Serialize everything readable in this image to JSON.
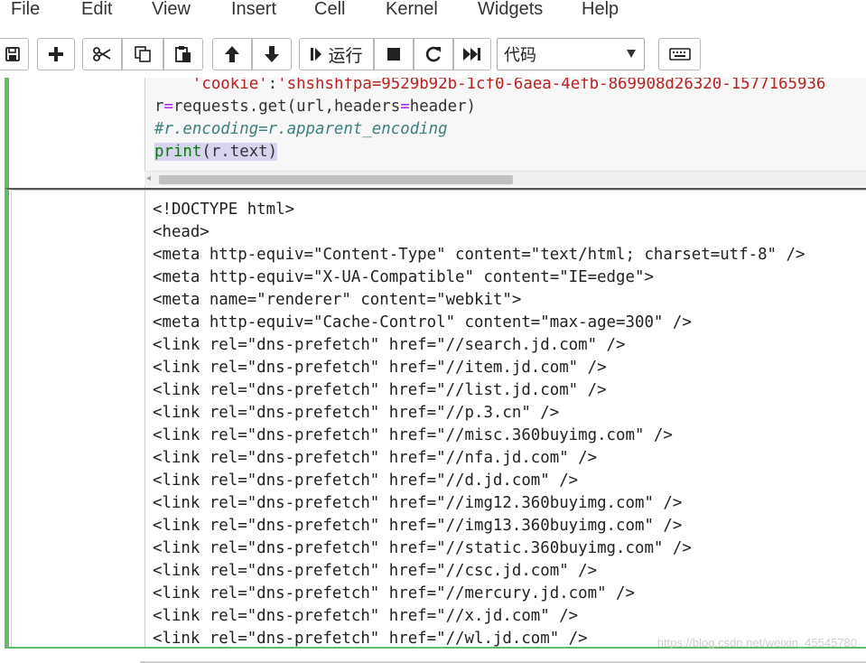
{
  "menu": [
    "File",
    "Edit",
    "View",
    "Insert",
    "Cell",
    "Kernel",
    "Widgets",
    "Help"
  ],
  "toolbar": {
    "run_label": "运行",
    "cell_type": "代码"
  },
  "cell1": {
    "lines": [
      {
        "parts": [
          [
            "",
            "    "
          ],
          [
            "str",
            "'cookie'"
          ],
          [
            "",
            ":"
          ],
          [
            "str",
            "'shshshfpa=9529b92b-1cf0-6aea-4efb-869908d26320-1577165936"
          ]
        ]
      },
      {
        "parts": [
          [
            "",
            "r"
          ],
          [
            "eq",
            "="
          ],
          [
            "",
            "requests.get(url,headers"
          ],
          [
            "eq",
            "="
          ],
          [
            "",
            "header)"
          ]
        ]
      },
      {
        "parts": [
          [
            "comment",
            "#r.encoding=r.apparent_encoding"
          ]
        ]
      },
      {
        "parts": [
          [
            "builtin-hl",
            "print"
          ],
          [
            "hl",
            "(r.text)"
          ]
        ]
      }
    ]
  },
  "output": {
    "lines": [
      "<!DOCTYPE html>",
      "<head>",
      "<meta http-equiv=\"Content-Type\" content=\"text/html; charset=utf-8\" />",
      "<meta http-equiv=\"X-UA-Compatible\" content=\"IE=edge\">",
      "<meta name=\"renderer\" content=\"webkit\">",
      "<meta http-equiv=\"Cache-Control\" content=\"max-age=300\" />",
      "<link rel=\"dns-prefetch\" href=\"//search.jd.com\" />",
      "<link rel=\"dns-prefetch\" href=\"//item.jd.com\" />",
      "<link rel=\"dns-prefetch\" href=\"//list.jd.com\" />",
      "<link rel=\"dns-prefetch\" href=\"//p.3.cn\" />",
      "<link rel=\"dns-prefetch\" href=\"//misc.360buyimg.com\" />",
      "<link rel=\"dns-prefetch\" href=\"//nfa.jd.com\" />",
      "<link rel=\"dns-prefetch\" href=\"//d.jd.com\" />",
      "<link rel=\"dns-prefetch\" href=\"//img12.360buyimg.com\" />",
      "<link rel=\"dns-prefetch\" href=\"//img13.360buyimg.com\" />",
      "<link rel=\"dns-prefetch\" href=\"//static.360buyimg.com\" />",
      "<link rel=\"dns-prefetch\" href=\"//csc.jd.com\" />",
      "<link rel=\"dns-prefetch\" href=\"//mercury.jd.com\" />",
      "<link rel=\"dns-prefetch\" href=\"//x.jd.com\" />",
      "<link rel=\"dns-prefetch\" href=\"//wl.jd.com\" />"
    ]
  },
  "watermark": "https://blog.csdn.net/weixin_45545780",
  "icons": {
    "save": "save-icon",
    "insert": "plus-icon",
    "cut": "scissors-icon",
    "copy": "copy-icon",
    "paste": "paste-icon",
    "up": "arrow-up-icon",
    "down": "arrow-down-icon",
    "run": "step-forward-icon",
    "stop": "stop-icon",
    "restart": "refresh-icon",
    "run_all": "fast-forward-icon",
    "palette": "keyboard-icon"
  },
  "colors": {
    "cell_border": "#66bb6a",
    "string": "#ba2121",
    "operator": "#aa22ff",
    "comment": "#408080",
    "builtin": "#008000"
  }
}
